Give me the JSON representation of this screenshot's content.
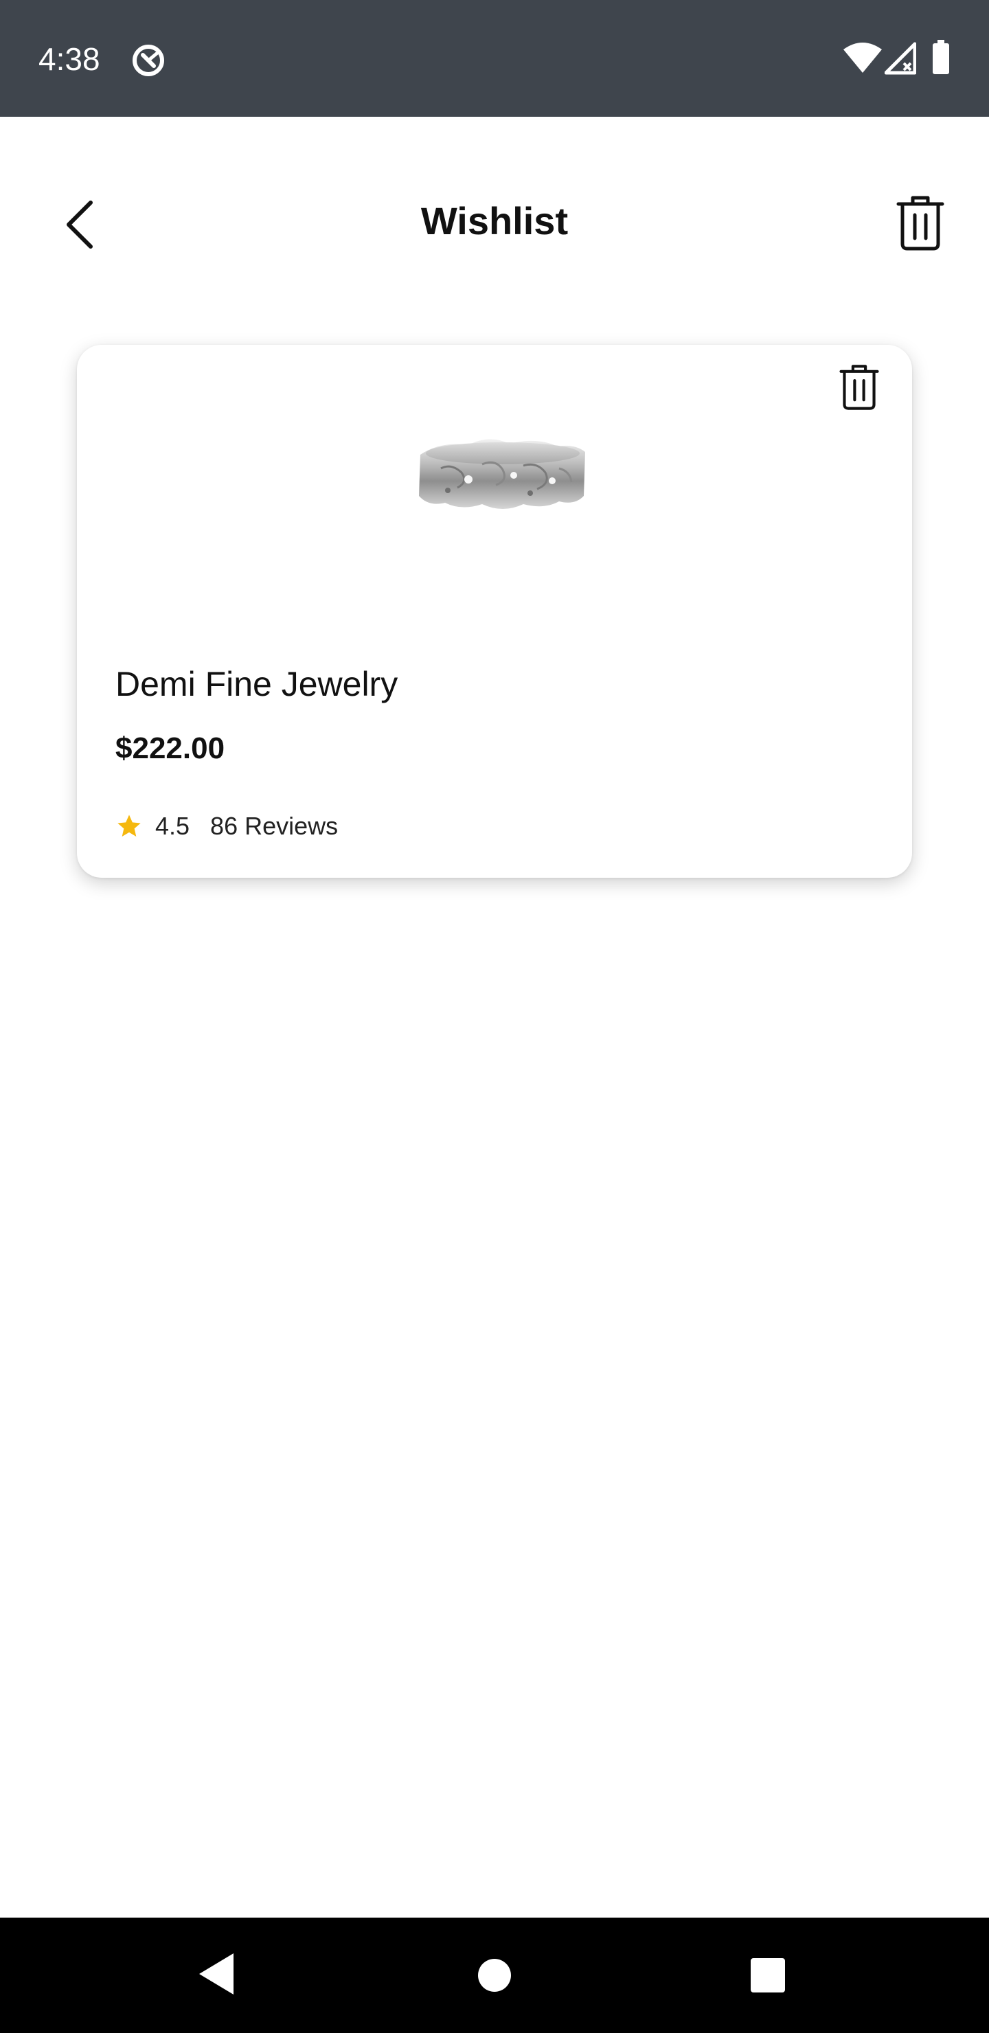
{
  "status_bar": {
    "time": "4:38",
    "icons": [
      "app-notification-icon",
      "wifi-icon",
      "cell-signal-icon",
      "battery-icon"
    ],
    "background_color": "#3f454d"
  },
  "app_bar": {
    "title": "Wishlist",
    "back_icon": "chevron-left-icon",
    "clear_icon": "trash-icon"
  },
  "wishlist": {
    "items": [
      {
        "name": "Demi Fine Jewelry",
        "price": "$222.00",
        "rating": "4.5",
        "reviews": "86 Reviews",
        "image": "silver-ring-image",
        "delete_icon": "trash-icon",
        "star_color": "#f5b80f"
      }
    ]
  },
  "nav_bar": {
    "icons": [
      "nav-back-icon",
      "nav-home-icon",
      "nav-recents-icon"
    ]
  }
}
